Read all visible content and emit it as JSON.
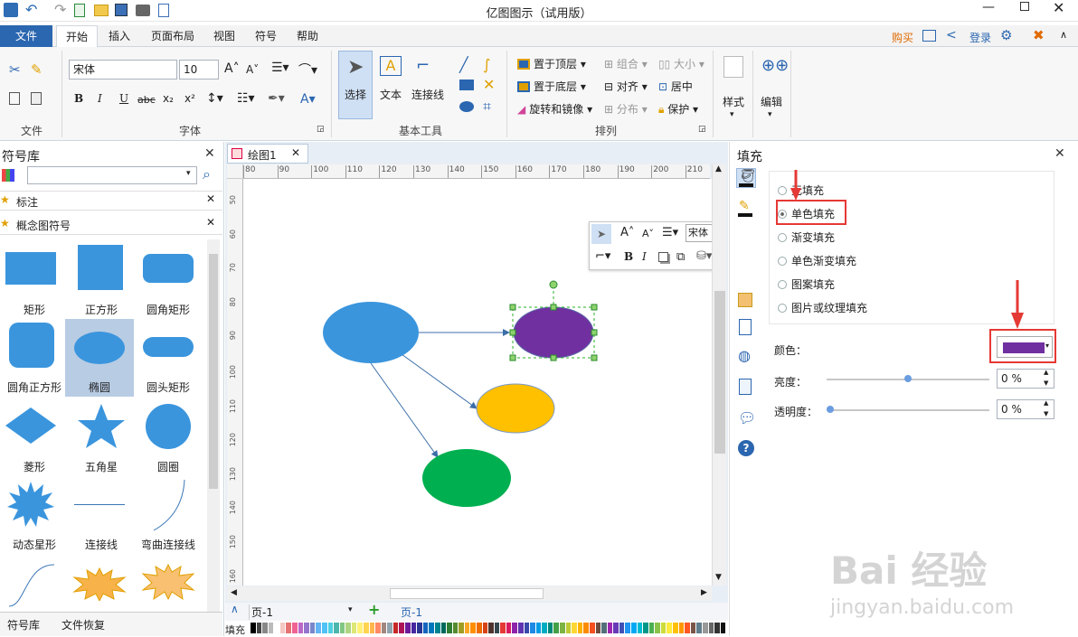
{
  "app": {
    "title": "亿图图示（试用版）"
  },
  "quick": {
    "file_tab": "文件"
  },
  "tabs": [
    "开始",
    "插入",
    "页面布局",
    "视图",
    "符号",
    "帮助"
  ],
  "top_right": {
    "buy": "购买",
    "login": "登录"
  },
  "ribbon": {
    "file_group": "文件",
    "font_group": "字体",
    "font_name": "宋体",
    "font_size": "10",
    "tools_group": "基本工具",
    "select": "选择",
    "text": "文本",
    "connector": "连接线",
    "arrange_group": "排列",
    "bring_front": "置于顶层",
    "send_back": "置于底层",
    "rotate": "旋转和镜像",
    "group": "组合",
    "align": "对齐",
    "distribute": "分布",
    "size": "大小",
    "center": "居中",
    "protect": "保护",
    "style": "样式",
    "edit": "编辑"
  },
  "library": {
    "title": "符号库",
    "search_placeholder": "",
    "cat1": "标注",
    "cat2": "概念图符号",
    "shapes": [
      "矩形",
      "正方形",
      "圆角矩形",
      "圆角正方形",
      "椭圆",
      "圆头矩形",
      "菱形",
      "五角星",
      "圆圈",
      "动态星形",
      "连接线",
      "弯曲连接线"
    ],
    "bottom_tab1": "符号库",
    "bottom_tab2": "文件恢复"
  },
  "doc": {
    "tab": "绘图1",
    "page_select": "页-1",
    "page_tab": "页-1",
    "fill_label": "填充",
    "ruler_h": [
      "80",
      "90",
      "100",
      "110",
      "120",
      "130",
      "140",
      "150",
      "160",
      "170",
      "180",
      "190",
      "200",
      "210"
    ],
    "ruler_v": [
      "50",
      "60",
      "70",
      "80",
      "90",
      "100",
      "110",
      "120",
      "130",
      "140",
      "150",
      "160"
    ]
  },
  "mini": {
    "font": "宋体"
  },
  "fill": {
    "title": "填充",
    "options": [
      "无填充",
      "单色填充",
      "渐变填充",
      "单色渐变填充",
      "图案填充",
      "图片或纹理填充"
    ],
    "selected": "单色填充",
    "color_label": "颜色：",
    "color": "#7030A0",
    "brightness_label": "亮度：",
    "brightness": "0 %",
    "transparency_label": "透明度：",
    "transparency": "0 %"
  },
  "canvas": {
    "shapes": [
      {
        "name": "blue",
        "color": "#3A95DD"
      },
      {
        "name": "purple",
        "color": "#7030A0"
      },
      {
        "name": "yellow",
        "color": "#FFC000"
      },
      {
        "name": "green",
        "color": "#00B050"
      }
    ]
  },
  "watermark": {
    "brand": "Bai 经验",
    "url": "jingyan.baidu.com"
  }
}
